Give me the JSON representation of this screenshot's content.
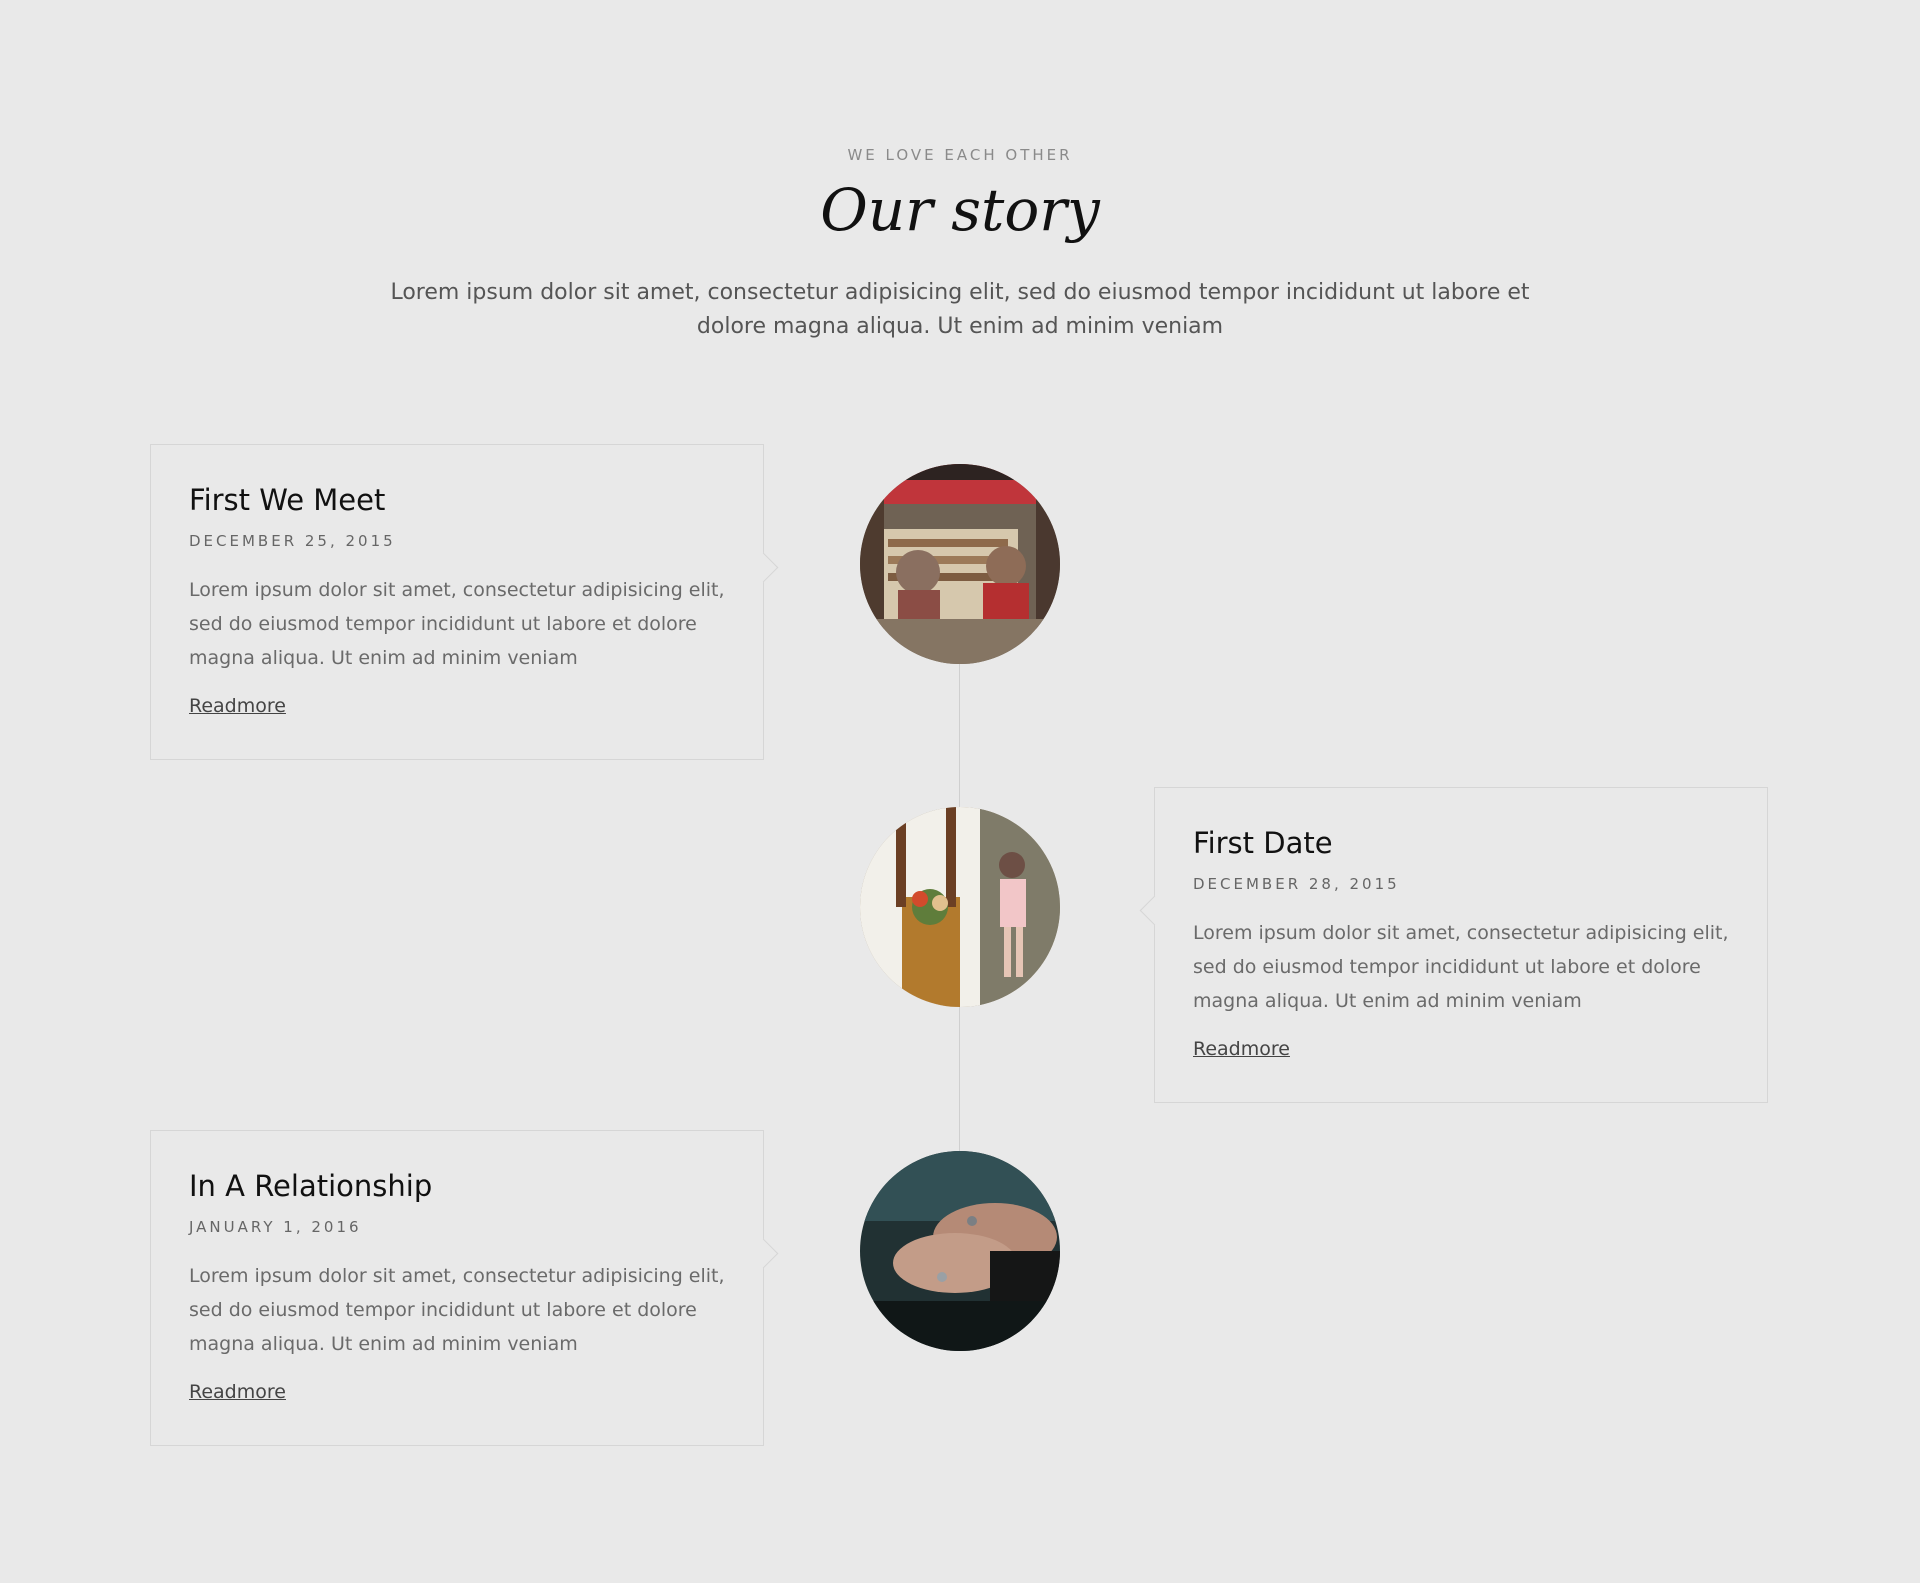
{
  "header": {
    "eyebrow": "WE LOVE EACH OTHER",
    "title": "Our story",
    "intro": "Lorem ipsum dolor sit amet, consectetur adipisicing elit, sed do eiusmod tempor incididunt ut labore et dolore magna aliqua. Ut enim ad minim veniam"
  },
  "timeline": [
    {
      "title": "First We Meet",
      "date": "DECEMBER 25, 2015",
      "text": "Lorem ipsum dolor sit amet, consectetur adipisicing elit, sed do eiusmod tempor incididunt ut labore et dolore magna aliqua. Ut enim ad minim veniam",
      "link": "Readmore"
    },
    {
      "title": "First Date",
      "date": "DECEMBER 28, 2015",
      "text": "Lorem ipsum dolor sit amet, consectetur adipisicing elit, sed do eiusmod tempor incididunt ut labore et dolore magna aliqua. Ut enim ad minim veniam",
      "link": "Readmore"
    },
    {
      "title": "In A Relationship",
      "date": "JANUARY 1, 2016",
      "text": "Lorem ipsum dolor sit amet, consectetur adipisicing elit, sed do eiusmod tempor incididunt ut labore et dolore magna aliqua. Ut enim ad minim veniam",
      "link": "Readmore"
    }
  ]
}
